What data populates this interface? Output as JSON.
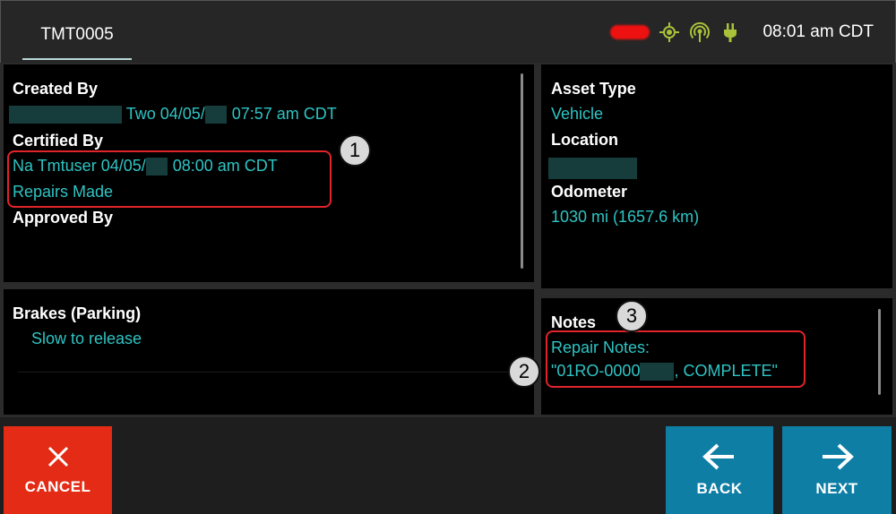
{
  "header": {
    "tab_label": "TMT0005",
    "time": "08:01 am CDT",
    "status_icons": [
      "signal-redacted",
      "gps-icon",
      "wifi-hotspot-icon",
      "plug-icon"
    ]
  },
  "details": {
    "created_by_label": "Created By",
    "created_by_value": "Two 04/05/",
    "created_by_time": "07:57 am CDT",
    "certified_by_label": "Certified By",
    "certified_by_value": "Na Tmtuser 04/05/",
    "certified_by_time": "08:00 am CDT",
    "certified_status": "Repairs Made",
    "approved_by_label": "Approved By"
  },
  "asset": {
    "asset_type_label": "Asset Type",
    "asset_type_value": "Vehicle",
    "location_label": "Location",
    "odometer_label": "Odometer",
    "odometer_value": "1030 mi (1657.6 km)"
  },
  "defect": {
    "title": "Brakes (Parking)",
    "description": "Slow to release"
  },
  "notes": {
    "label": "Notes",
    "repair_notes_label": "Repair Notes:",
    "repair_notes_prefix": "\"01RO-0000",
    "repair_notes_suffix": ", COMPLETE\""
  },
  "callouts": {
    "one": "1",
    "two": "2",
    "three": "3"
  },
  "buttons": {
    "cancel": "CANCEL",
    "back": "BACK",
    "next": "NEXT"
  },
  "colors": {
    "accent_text": "#2ec4c4",
    "cancel": "#e32b15",
    "nav": "#0f7ea5",
    "callout": "#e0242a"
  }
}
